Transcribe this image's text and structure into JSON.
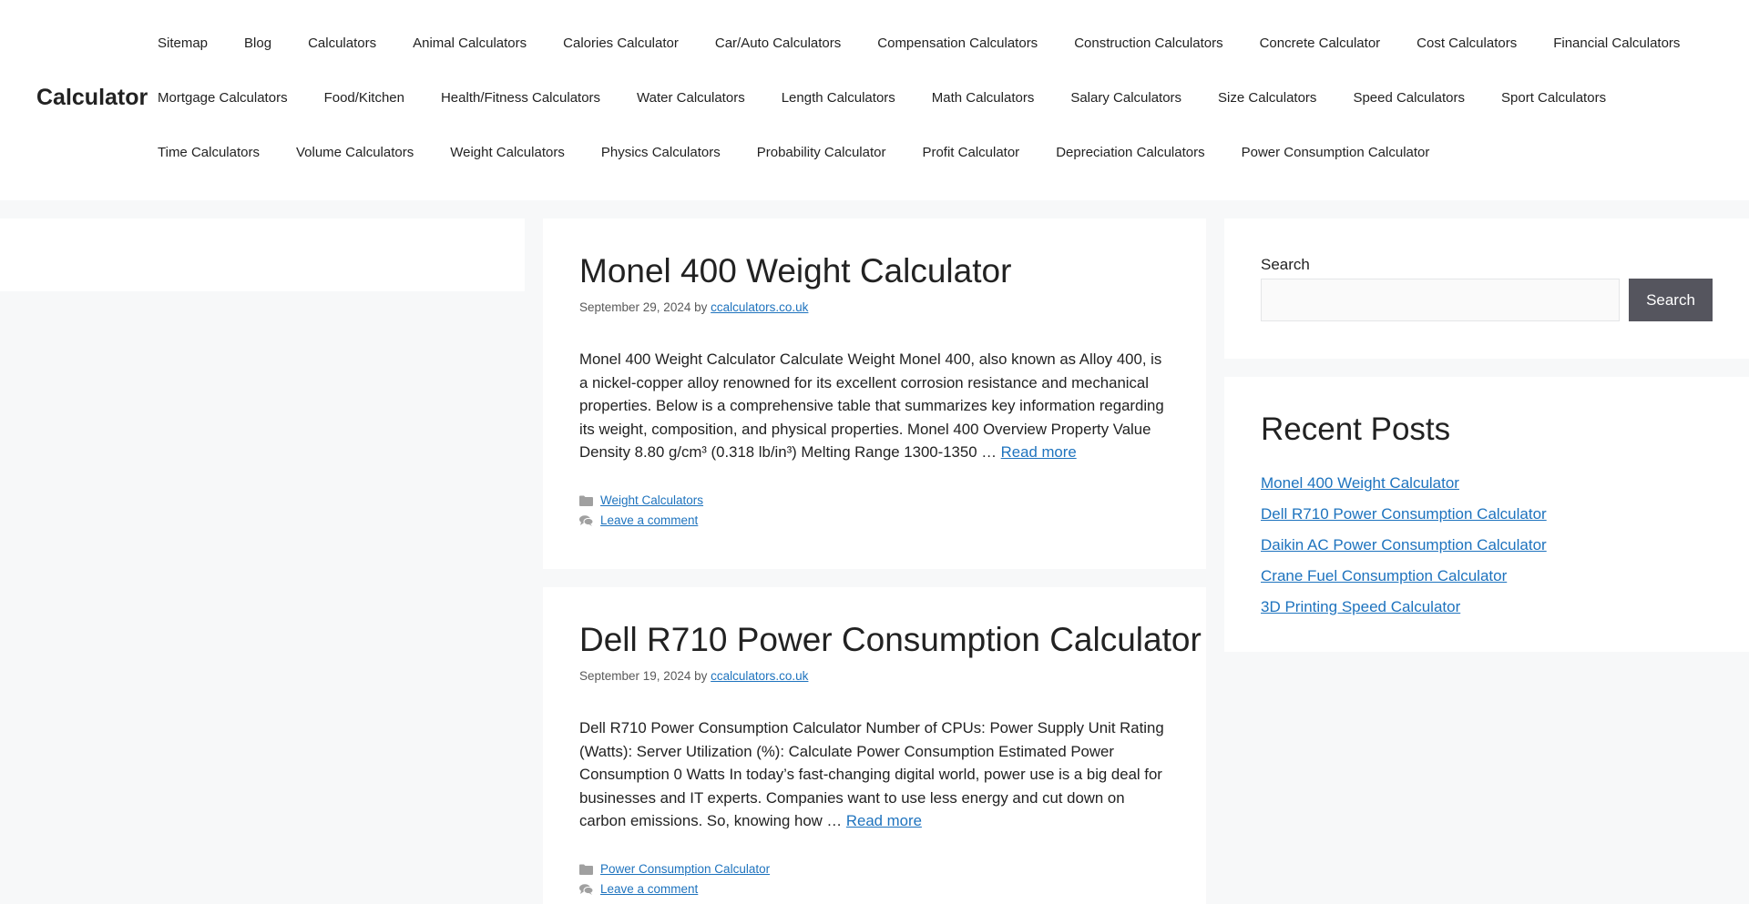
{
  "header": {
    "site_title": "Calculator",
    "nav_rows": [
      [
        "Sitemap",
        "Blog",
        "Calculators",
        "Animal Calculators",
        "Calories Calculator",
        "Car/Auto Calculators",
        "Compensation Calculators",
        "Construction Calculators",
        "Concrete Calculator",
        "Cost Calculators",
        "Financial Calculators"
      ],
      [
        "Mortgage Calculators",
        "Food/Kitchen",
        "Health/Fitness Calculators",
        "Water Calculators",
        "Length Calculators",
        "Math Calculators",
        "Salary Calculators",
        "Size Calculators",
        "Speed Calculators",
        "Sport Calculators"
      ],
      [
        "Time Calculators",
        "Volume Calculators",
        "Weight Calculators",
        "Physics Calculators",
        "Probability Calculator",
        "Profit Calculator",
        "Depreciation Calculators",
        "Power Consumption Calculator"
      ]
    ]
  },
  "posts": [
    {
      "title": "Monel 400 Weight Calculator",
      "date": "September 29, 2024",
      "by": "by",
      "author": "ccalculators.co.uk",
      "summary": "Monel 400 Weight Calculator Calculate Weight Monel 400, also known as Alloy 400, is a nickel-copper alloy renowned for its excellent corrosion resistance and mechanical properties. Below is a comprehensive table that summarizes key information regarding its weight, composition, and physical properties. Monel 400 Overview Property Value Density 8.80 g/cm³ (0.318 lb/in³) Melting Range 1300-1350 …",
      "read_more": "Read more",
      "category": "Weight Calculators",
      "comment": "Leave a comment"
    },
    {
      "title": "Dell R710 Power Consumption Calculator",
      "date": "September 19, 2024",
      "by": "by",
      "author": "ccalculators.co.uk",
      "summary": "Dell R710 Power Consumption Calculator Number of CPUs: Power Supply Unit Rating (Watts): Server Utilization (%): Calculate Power Consumption Estimated Power Consumption 0 Watts In today’s fast-changing digital world, power use is a big deal for businesses and IT experts. Companies want to use less energy and cut down on carbon emissions. So, knowing how …",
      "read_more": "Read more",
      "category": "Power Consumption Calculator",
      "comment": "Leave a comment"
    }
  ],
  "sidebar": {
    "search": {
      "label": "Search",
      "placeholder": "",
      "value": "",
      "button": "Search"
    },
    "recent": {
      "title": "Recent Posts",
      "items": [
        "Monel 400 Weight Calculator",
        "Dell R710 Power Consumption Calculator",
        "Daikin AC Power Consumption Calculator",
        "Crane Fuel Consumption Calculator",
        "3D Printing Speed Calculator"
      ]
    }
  },
  "colors": {
    "link": "#1e73be",
    "button_bg": "#55555e",
    "page_bg": "#f7f8f9"
  },
  "icons": [
    "folder-icon",
    "comments-icon"
  ]
}
